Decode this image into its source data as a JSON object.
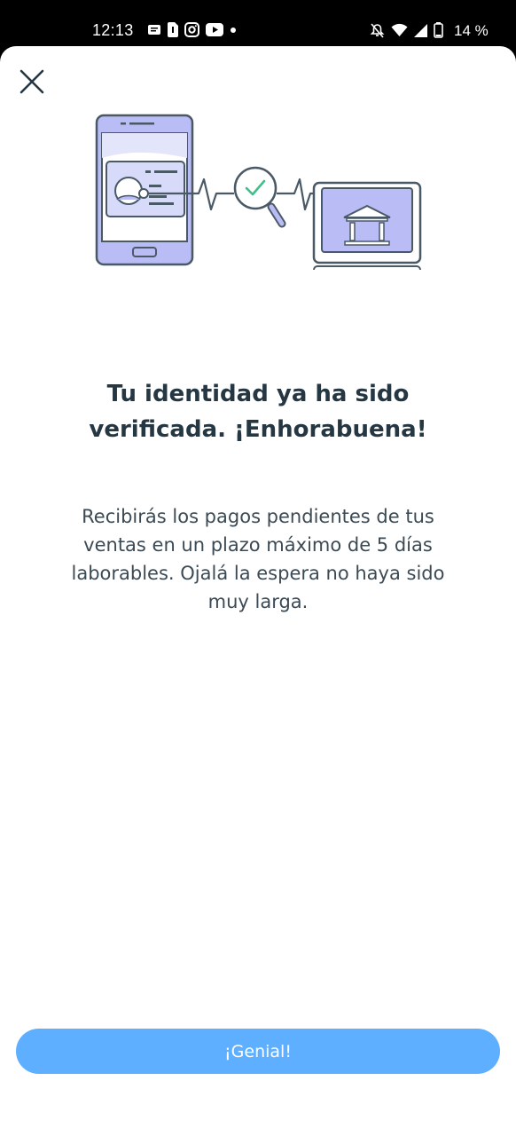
{
  "status_bar": {
    "time": "12:13",
    "battery_percent": "14 %",
    "left_icons": [
      "message-icon",
      "sim-icon",
      "instagram-icon",
      "youtube-icon",
      "dot-icon"
    ],
    "right_icons": [
      "mute-icon",
      "wifi-icon",
      "signal-icon",
      "battery-icon"
    ]
  },
  "header": {
    "close_icon": "close-icon"
  },
  "illustration": {
    "name": "identity-verification-illustration",
    "colors": {
      "stroke": "#4a5966",
      "fill": "#b9bcf5",
      "check": "#3ec08a"
    }
  },
  "content": {
    "title_line1": "Tu identidad ya ha sido",
    "title_line2": "verificada. ¡Enhorabuena!",
    "body_line1": "Recibirás los pagos pendientes de tus",
    "body_line2": "ventas en un plazo máximo de 5 días",
    "body_line3": "laborables. Ojalá la espera no haya sido",
    "body_line4": "muy larga."
  },
  "footer": {
    "button_label": "¡Genial!",
    "button_color": "#5eafff"
  }
}
